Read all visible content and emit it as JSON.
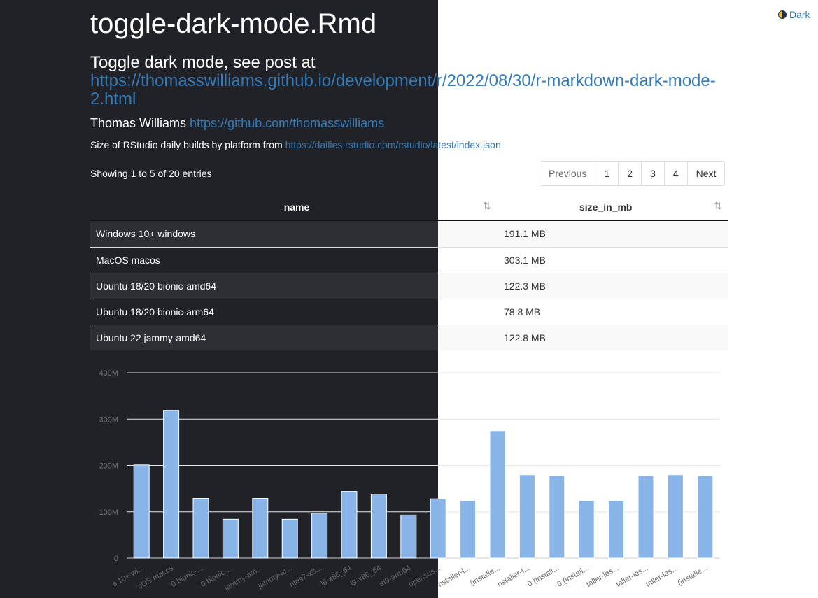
{
  "toggle": {
    "label": "Dark"
  },
  "header": {
    "title": "toggle-dark-mode.Rmd",
    "subtitle_prefix": "Toggle dark mode, see post at",
    "subtitle_link": "https://thomasswilliams.github.io/development/r/2022/08/30/r-markdown-dark-mode-2.html",
    "author_name": "Thomas Williams",
    "author_link": "https://github.com/thomasswilliams"
  },
  "description": {
    "text": "Size of RStudio daily builds by platform from",
    "link": "https://dailies.rstudio.com/rstudio/latest/index.json"
  },
  "table": {
    "info": "Showing 1 to 5 of 20 entries",
    "columns": [
      "name",
      "size_in_mb"
    ],
    "rows": [
      [
        "Windows 10+ windows",
        "191.1 MB"
      ],
      [
        "MacOS macos",
        "303.1 MB"
      ],
      [
        "Ubuntu 18/20 bionic-amd64",
        "122.3 MB"
      ],
      [
        "Ubuntu 18/20 bionic-arm64",
        "78.8 MB"
      ],
      [
        "Ubuntu 22 jammy-amd64",
        "122.8 MB"
      ]
    ]
  },
  "pagination": {
    "previous": "Previous",
    "pages": [
      "1",
      "2",
      "3",
      "4"
    ],
    "next": "Next"
  },
  "colors": {
    "dark_bg": "#212227",
    "link": "#337ab7",
    "bar": "#89b4e8"
  },
  "chart_data": {
    "type": "bar",
    "categories": [
      "s 10+ wi...",
      "cOS macos",
      "0 bionic-...",
      "0 bionic-...",
      "jammy-am...",
      "jammy-ar...",
      "ntos7-x8...",
      "l8-x86_64",
      "l9-x86_64",
      "el9-arm64",
      "opensus...",
      "nstaller-l...",
      "(installe...",
      "nstaller-l...",
      "0 (install...",
      "0 (install...",
      "taller-les...",
      "taller-les...",
      "taller-les...",
      "(installe..."
    ],
    "values": [
      201,
      319,
      129,
      84,
      129,
      84,
      97,
      144,
      138,
      93,
      128,
      124,
      275,
      180,
      178,
      124,
      124,
      178,
      180,
      178
    ],
    "ylim": [
      0,
      400
    ],
    "yticks": [
      "0",
      "100M",
      "200M",
      "300M",
      "400M"
    ],
    "grid": true
  }
}
